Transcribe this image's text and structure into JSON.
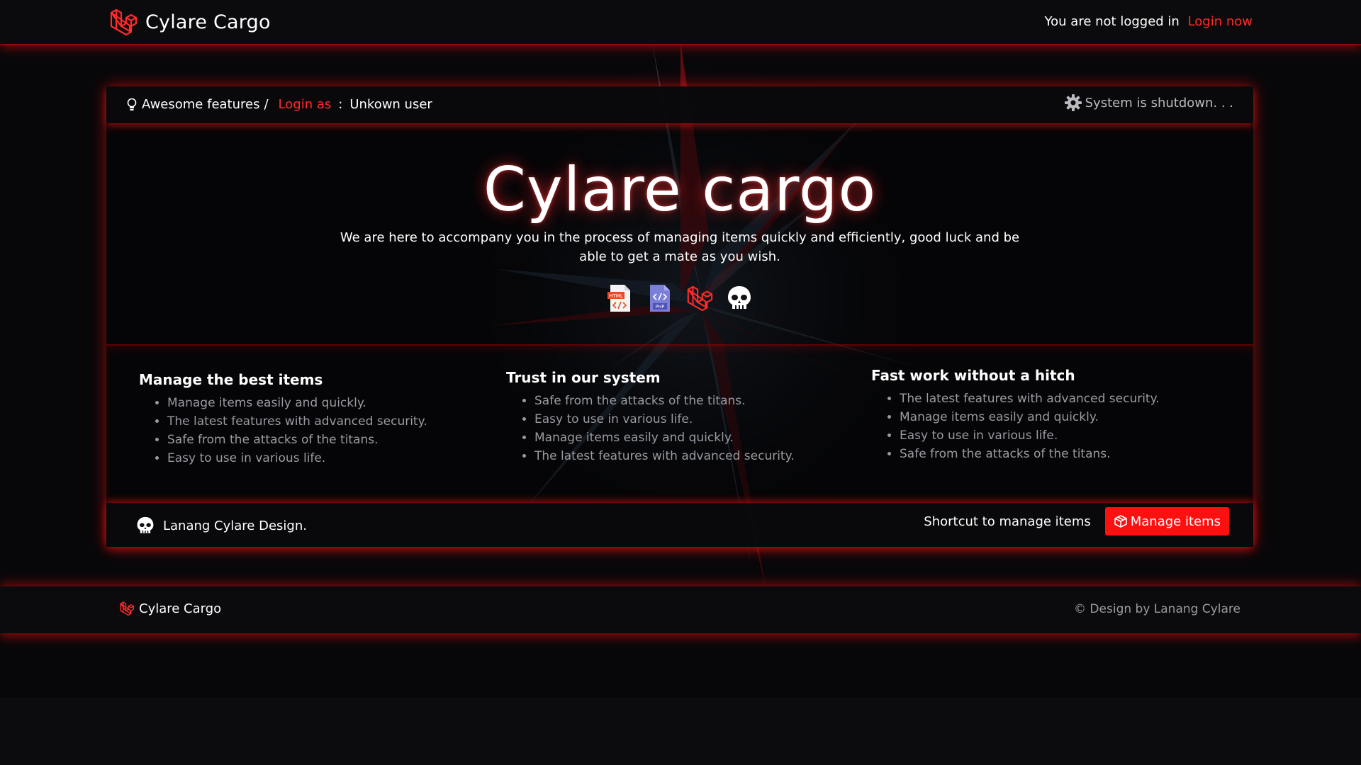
{
  "navbar": {
    "brand": "Cylare Cargo",
    "auth_text": "You are not logged in",
    "login_link": "Login now"
  },
  "card": {
    "breadcrumb": {
      "item1": "Awesome features",
      "separator": "/",
      "login_as": "Login as",
      "colon": ":",
      "user": "Unkown user"
    },
    "status": "System is shutdown. . .",
    "hero": {
      "title": "Cylare cargo",
      "subtitle": "We are here to accompany you in the process of managing items quickly and efficiently, good luck and be able to get a mate as you wish.",
      "tech_icons": [
        "html-file-icon",
        "php-file-icon",
        "laravel-icon",
        "skull-icon"
      ],
      "html_badge": "HTML",
      "php_badge": "PHP"
    },
    "features": [
      {
        "title": "Manage the best items",
        "items": [
          "Manage items easily and quickly.",
          "The latest features with advanced security.",
          "Safe from the attacks of the titans.",
          "Easy to use in various life."
        ]
      },
      {
        "title": "Trust in our system",
        "items": [
          "Safe from the attacks of the titans.",
          "Easy to use in various life.",
          "Manage items easily and quickly.",
          "The latest features with advanced security."
        ]
      },
      {
        "title": "Fast work without a hitch",
        "items": [
          "The latest features with advanced security.",
          "Manage items easily and quickly.",
          "Easy to use in various life.",
          "Safe from the attacks of the titans."
        ]
      }
    ],
    "footer": {
      "designer": "Lanang Cylare Design.",
      "shortcut_label": "Shortcut to manage items",
      "manage_button": "Manage items"
    }
  },
  "site_footer": {
    "brand": "Cylare Cargo",
    "credit": "© Design by Lanang Cylare"
  },
  "colors": {
    "accent": "#ff1010",
    "link": "#ff2a2a",
    "background": "#070709",
    "muted_text": "#9a9aa2"
  }
}
